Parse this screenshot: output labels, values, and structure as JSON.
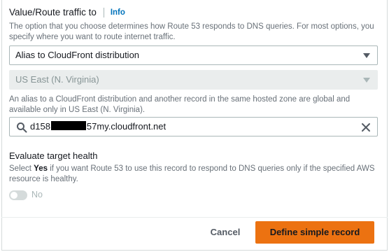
{
  "field": {
    "label": "Value/Route traffic to",
    "info_link": "Info",
    "description": "The option that you choose determines how Route 53 responds to DNS queries. For most options, you specify where you want to route internet traffic."
  },
  "endpoint_select": {
    "value": "Alias to CloudFront distribution"
  },
  "region_select": {
    "value": "US East (N. Virginia)",
    "disabled": true
  },
  "alias_note": "An alias to a CloudFront distribution and another record in the same hosted zone are global and available only in US East (N. Virginia).",
  "distribution_search": {
    "value_prefix": "d158",
    "value_suffix": "57my.cloudfront.net"
  },
  "evaluate_health": {
    "title": "Evaluate target health",
    "desc_prefix": "Select ",
    "desc_bold": "Yes",
    "desc_suffix": " if you want Route 53 to use this record to respond to DNS queries only if the specified AWS resource is healthy.",
    "toggle_label": "No",
    "toggle_on": false
  },
  "footer": {
    "cancel_label": "Cancel",
    "primary_label": "Define simple record"
  },
  "colors": {
    "primary": "#ec7211",
    "link": "#0073bb",
    "muted": "#687078"
  }
}
